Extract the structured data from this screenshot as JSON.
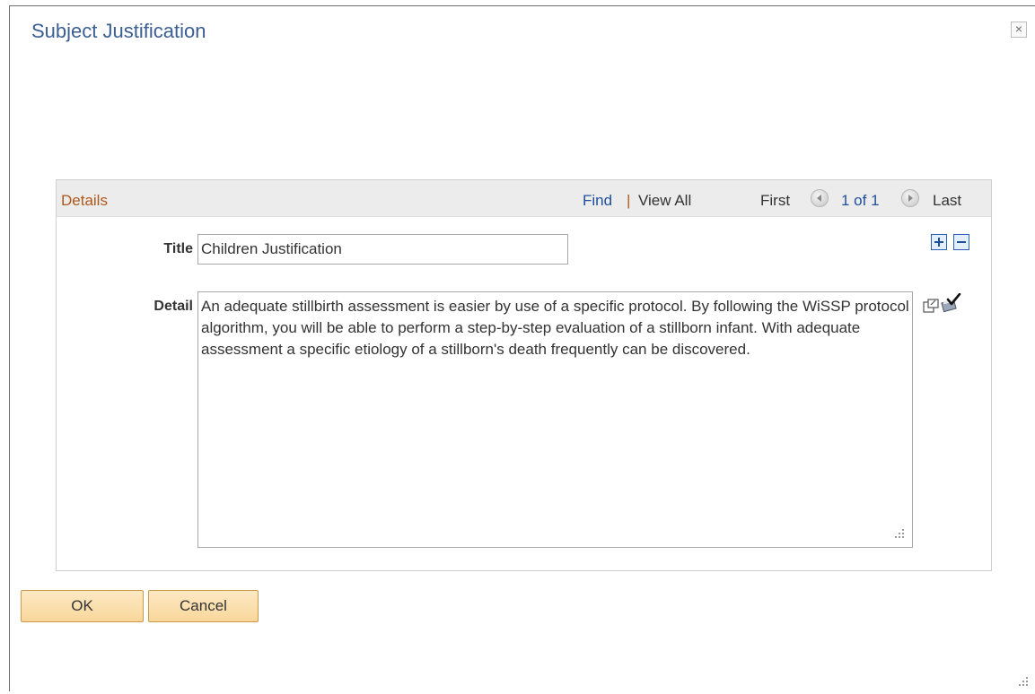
{
  "dialog": {
    "title": "Subject Justification",
    "close_symbol": "×"
  },
  "details": {
    "section_label": "Details",
    "nav": {
      "find": "Find",
      "separator": "|",
      "view_all": "View All",
      "first": "First",
      "count": "1 of 1",
      "last": "Last"
    },
    "title_label": "Title",
    "title_value": "Children Justification",
    "detail_label": "Detail",
    "detail_value": "An adequate stillbirth assessment is easier by use of a specific protocol. By following the WiSSP protocol algorithm, you will be able to perform a step-by-step evaluation of a stillborn infant. With adequate assessment a specific etiology of a stillborn's death frequently can be discovered."
  },
  "buttons": {
    "ok": "OK",
    "cancel": "Cancel"
  },
  "icons": {
    "close": "close-icon",
    "prev": "prev-arrow-icon",
    "next": "next-arrow-icon",
    "add_row": "plus-icon",
    "delete_row": "minus-icon",
    "expand": "expand-icon",
    "spellcheck": "spellcheck-icon"
  },
  "colors": {
    "title_blue": "#3b5f92",
    "section_orange": "#b0571a",
    "link_blue": "#1f4f9a",
    "button_fill": "#f9d79b"
  }
}
